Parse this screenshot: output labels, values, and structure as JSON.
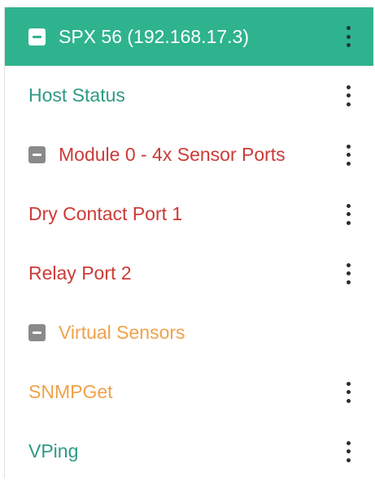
{
  "colors": {
    "header_bg": "#2fb38f",
    "teal": "#2e9a84",
    "red": "#cc3b37",
    "orange": "#f0a24a",
    "toggle_gray": "#8a8a8a"
  },
  "tree": {
    "host": {
      "label": "SPX 56 (192.168.17.3)",
      "toggle_icon": "minus-square-icon",
      "menu_icon": "kebab-vertical-icon"
    },
    "host_status": {
      "label": "Host Status",
      "menu_icon": "kebab-vertical-icon"
    },
    "module0": {
      "label": "Module 0 - 4x Sensor Ports",
      "toggle_icon": "minus-square-icon",
      "menu_icon": "kebab-vertical-icon",
      "children": [
        {
          "label": "Dry Contact Port 1"
        },
        {
          "label": "Relay Port 2"
        }
      ]
    },
    "virtual_sensors": {
      "label": "Virtual Sensors",
      "toggle_icon": "minus-square-icon",
      "children": [
        {
          "label": "SNMPGet"
        },
        {
          "label": "VPing"
        }
      ]
    }
  }
}
